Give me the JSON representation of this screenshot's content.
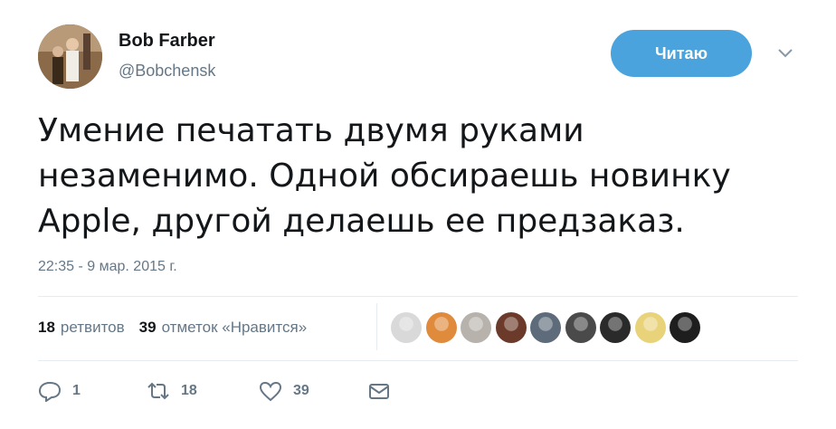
{
  "author": {
    "name": "Bob Farber",
    "handle": "@Bobchensk"
  },
  "follow_button": {
    "label": "Читаю",
    "color": "#4aa3dc"
  },
  "tweet": {
    "lines": [
      "Умение печатать двумя руками",
      "незаменимо. Одной обсираешь новинку",
      "Apple, другой делаешь ее предзаказ."
    ],
    "timestamp": "22:35 - 9 мар. 2015 г."
  },
  "stats": {
    "retweets_count": "18",
    "retweets_label": "ретвитов",
    "likes_count": "39",
    "likes_label": "отметок «Нравится»"
  },
  "likers": [
    {
      "icon": "liker-avatar-1",
      "color": "#d9d9d9"
    },
    {
      "icon": "liker-avatar-2",
      "color": "#e08a3c"
    },
    {
      "icon": "liker-avatar-3",
      "color": "#b8b2ac"
    },
    {
      "icon": "liker-avatar-4",
      "color": "#6b3a2a"
    },
    {
      "icon": "liker-avatar-5",
      "color": "#5d6b7a"
    },
    {
      "icon": "liker-avatar-6",
      "color": "#4a4a4a"
    },
    {
      "icon": "liker-avatar-7",
      "color": "#2a2a2a"
    },
    {
      "icon": "liker-avatar-8",
      "color": "#e8d27a"
    },
    {
      "icon": "liker-avatar-9",
      "color": "#1e1e1e"
    }
  ],
  "actions": {
    "reply_count": "1",
    "retweet_count": "18",
    "like_count": "39"
  },
  "colors": {
    "secondary_text": "#657786",
    "divider": "#e6ecf0"
  }
}
